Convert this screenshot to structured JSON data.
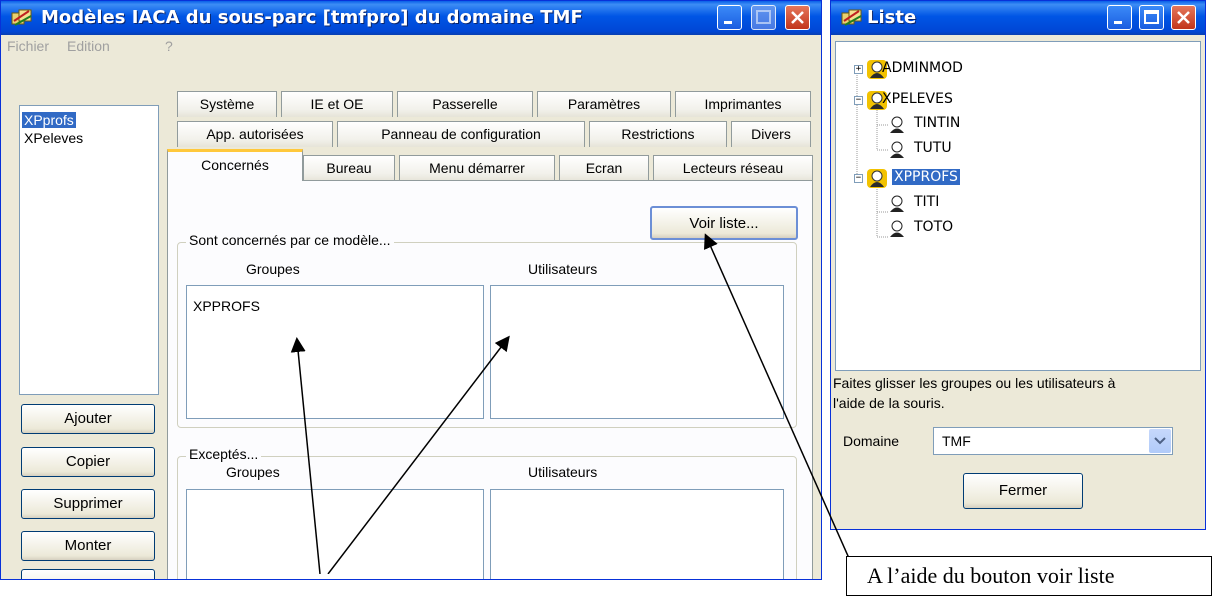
{
  "main_window": {
    "title": "Modèles IACA du sous-parc [tmfpro] du domaine TMF",
    "menu": [
      "Fichier",
      "Edition",
      "?"
    ],
    "models": [
      "XPprofs",
      "XPeleves"
    ],
    "selected_model": "XPprofs",
    "buttons": {
      "add": "Ajouter",
      "copy": "Copier",
      "delete": "Supprimer",
      "up": "Monter"
    },
    "tabs_row1": [
      "Système",
      "IE et OE",
      "Passerelle",
      "Paramètres",
      "Imprimantes"
    ],
    "tabs_row2": [
      "App. autorisées",
      "Panneau de configuration",
      "Restrictions",
      "Divers"
    ],
    "tabs_row3": [
      "Concernés",
      "Bureau",
      "Menu démarrer",
      "Ecran",
      "Lecteurs réseau"
    ],
    "active_tab": "Concernés",
    "voir_liste": "Voir liste...",
    "concerned": {
      "legend": "Sont concernés par ce modèle...",
      "groups_header": "Groupes",
      "users_header": "Utilisateurs",
      "groups": [
        "XPPROFS"
      ],
      "users": []
    },
    "excepted": {
      "legend": "Exceptés...",
      "groups_header": "Groupes",
      "users_header": "Utilisateurs",
      "groups": [],
      "users": []
    }
  },
  "list_window": {
    "title": "Liste",
    "tree": [
      {
        "label": "ADMINMOD",
        "type": "group",
        "expander": "+"
      },
      {
        "label": "XPELEVES",
        "type": "group",
        "expander": "-"
      },
      {
        "label": "TINTIN",
        "type": "user"
      },
      {
        "label": "TUTU",
        "type": "user"
      },
      {
        "label": "XPPROFS",
        "type": "group",
        "expander": "-",
        "selected": true
      },
      {
        "label": "TITI",
        "type": "user"
      },
      {
        "label": "TOTO",
        "type": "user"
      }
    ],
    "hint_line1": "Faites glisser les groupes ou les utilisateurs à",
    "hint_line2": "l'aide de la souris.",
    "domain_label": "Domaine",
    "domain_value": "TMF",
    "close_button": "Fermer"
  },
  "annotation": {
    "callout_text": "A l’aide du bouton voir liste"
  },
  "colors": {
    "title_blue": "#0055e5",
    "selection": "#316ac5",
    "window_bg": "#ece9d8",
    "active_tab_accent": "#ffc83c"
  }
}
